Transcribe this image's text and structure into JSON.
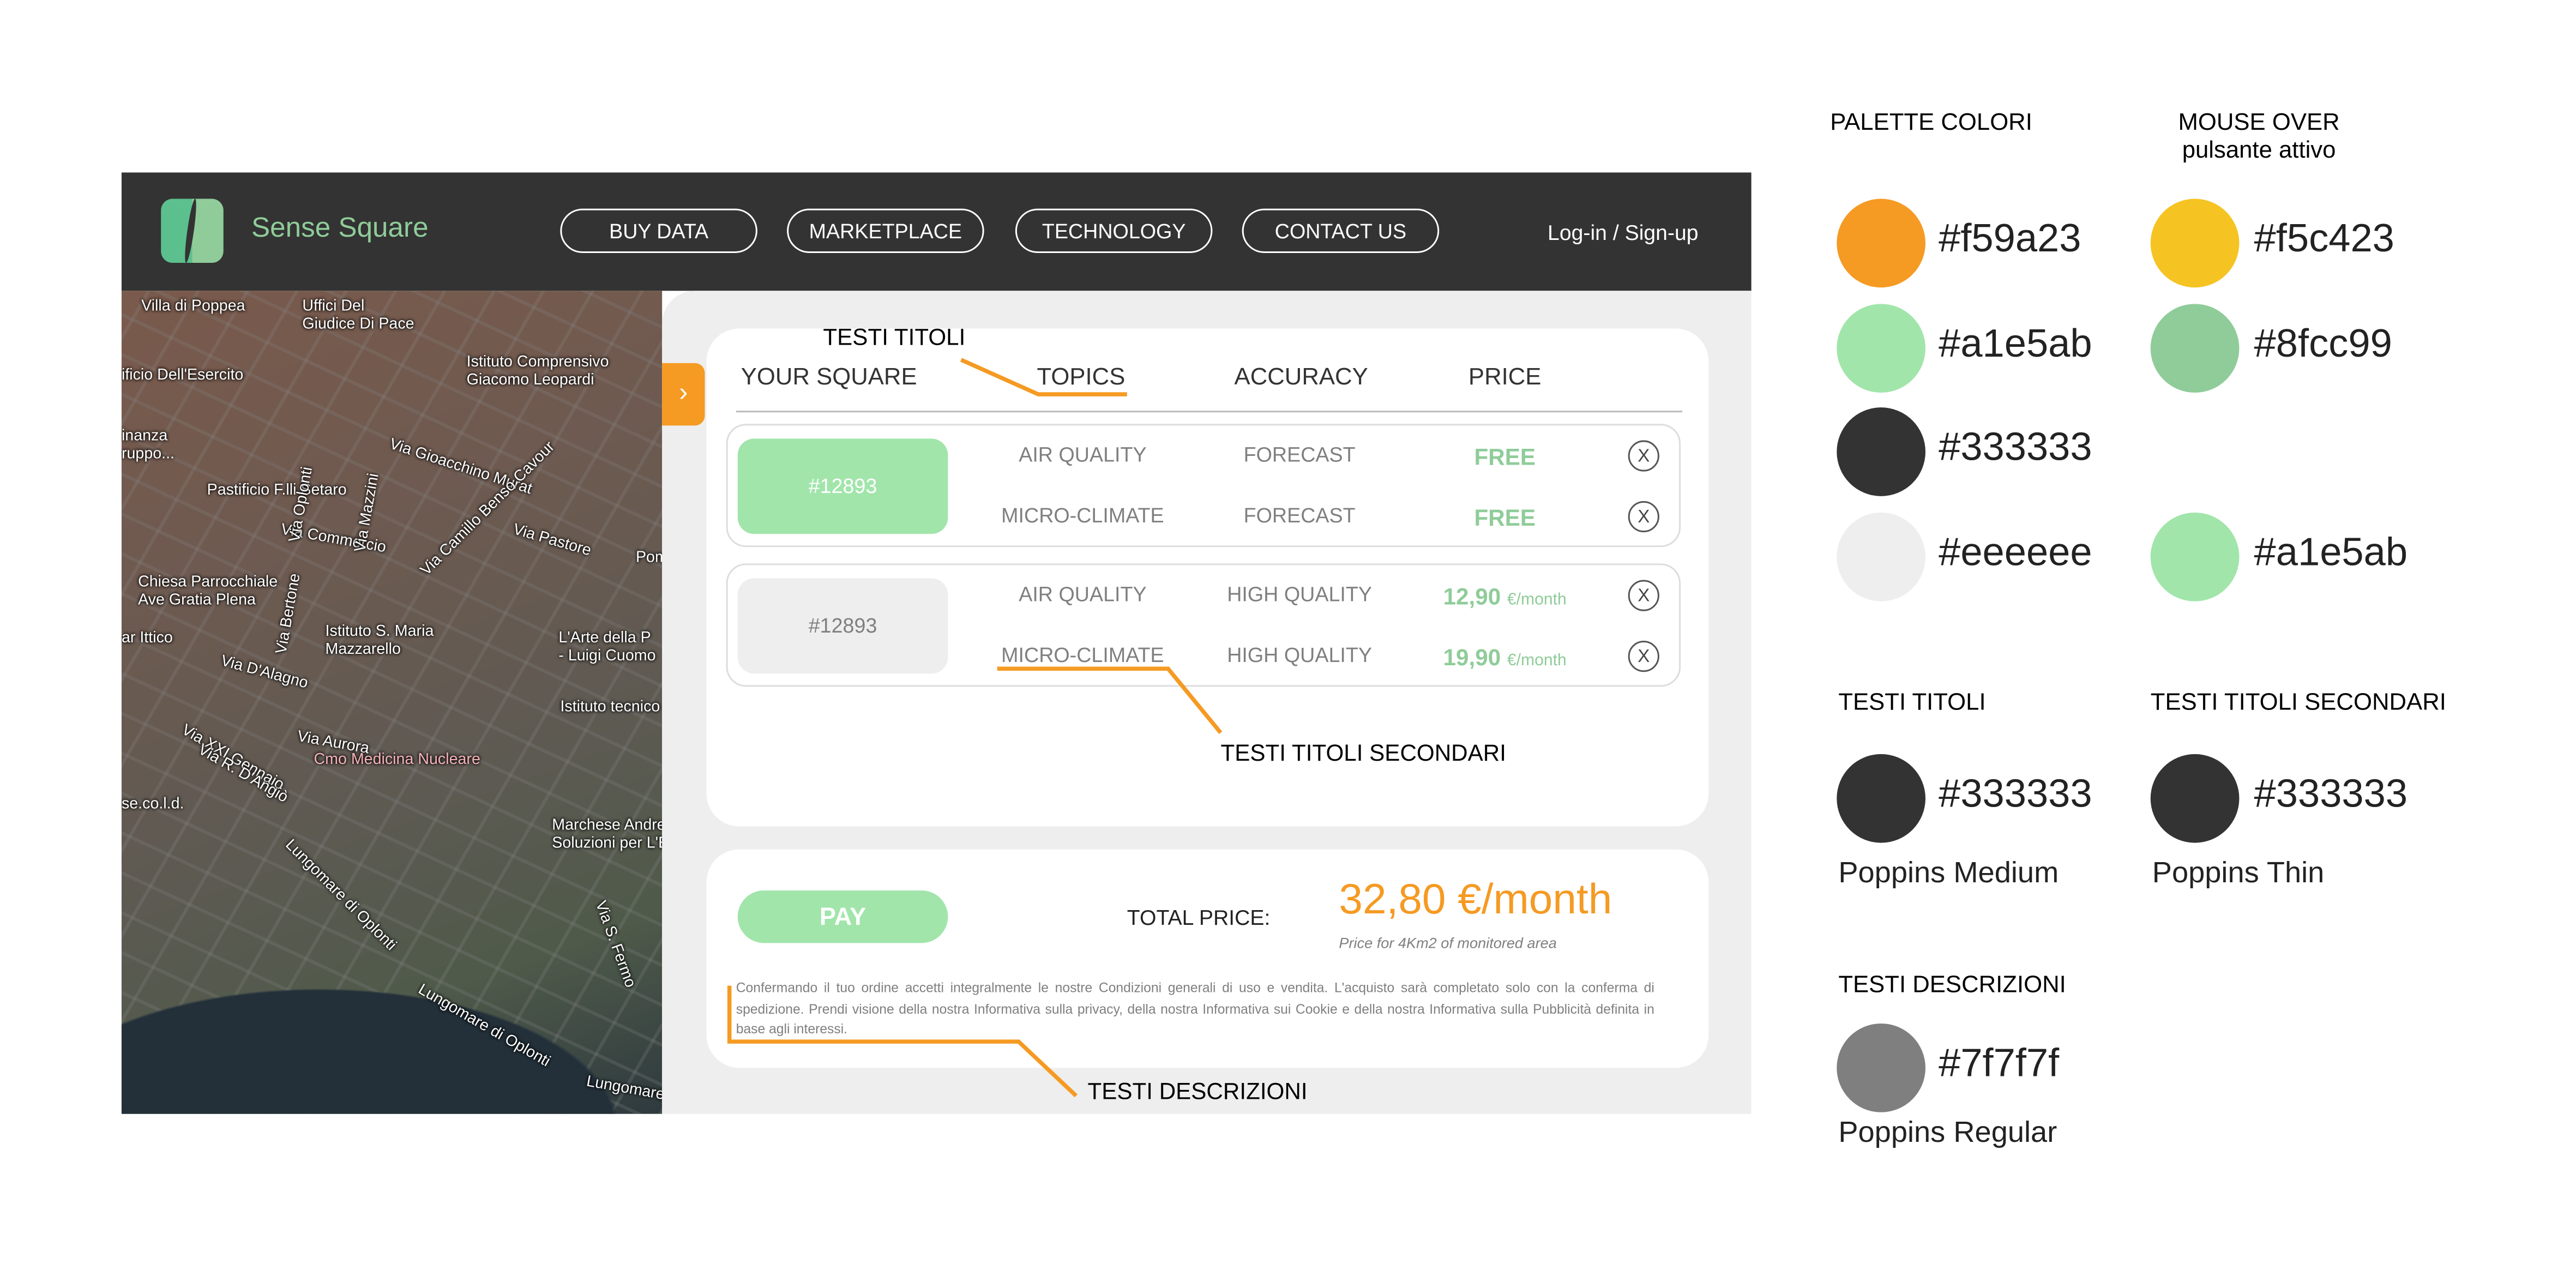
{
  "navbar": {
    "brand": "Sense Square",
    "buttons": [
      "BUY DATA",
      "MARKETPLACE",
      "TECHNOLOGY",
      "CONTACT US"
    ],
    "login": "Log-in / Sign-up"
  },
  "map": {
    "labels": [
      "Villa di Poppea",
      "Uffici Del\nGiudice Di Pace",
      "Istituto Comprensivo\nGiacomo Leopardi",
      "ificio Dell'Esercito",
      "inanza\nruppo...",
      "Via Gioacchino Murat",
      "Pastificio F.lli Setaro",
      "Via Commercio",
      "Via Pastore",
      "Via Oplonti",
      "Via Mazzini",
      "Via Camillo Benso Cavour",
      "Pom",
      "Chiesa Parrocchiale\nAve Gratia Plena",
      "ar Ittico",
      "Via D'Alagno",
      "Via Bertone",
      "Istituto S. Maria\nMazzarello",
      "L'Arte della P\n- Luigi Cuomo",
      "Istituto tecnico Marconi",
      "Via XXI Gennaio",
      "Via R. D'Angiò",
      "Via Aurora",
      "Cmo Medicina Nucleare",
      "se.co.l.d.",
      "Marchese Andrea\nSoluzioni per L'Edilizia",
      "Lungomare di Oplonti",
      "Via S. Fermo",
      "Lungomare di Oplonti",
      "Lungomare di Oplo"
    ]
  },
  "order": {
    "headers": [
      "YOUR SQUARE",
      "TOPICS",
      "ACCURACY",
      "PRICE"
    ],
    "groups": [
      {
        "square": "#12893",
        "selected": true,
        "rows": [
          {
            "topic": "AIR QUALITY",
            "accuracy": "FORECAST",
            "price": "FREE",
            "unit": ""
          },
          {
            "topic": "MICRO-CLIMATE",
            "accuracy": "FORECAST",
            "price": "FREE",
            "unit": ""
          }
        ]
      },
      {
        "square": "#12893",
        "selected": false,
        "rows": [
          {
            "topic": "AIR QUALITY",
            "accuracy": "HIGH QUALITY",
            "price": "12,90",
            "unit": "€/month"
          },
          {
            "topic": "MICRO-CLIMATE",
            "accuracy": "HIGH QUALITY",
            "price": "19,90",
            "unit": "€/month"
          }
        ]
      }
    ],
    "remove_icon": "X"
  },
  "checkout": {
    "pay": "PAY",
    "total_label": "TOTAL PRICE:",
    "total": "32,80 €/month",
    "note": "Price for 4Km2 of monitored area",
    "description": "Confermando il tuo ordine accetti integralmente le nostre Condizioni generali di uso e vendita. L'acquisto sarà completato solo con la conferma di spedizione. Prendi visione della nostra Informativa sulla privacy, della nostra Informativa sui Cookie e della nostra Informativa sulla Pubblicità definita in base agli interessi."
  },
  "annotations": {
    "titles": "TESTI TITOLI",
    "secondary": "TESTI TITOLI SECONDARI",
    "descriptions": "TESTI DESCRIZIONI"
  },
  "palette": {
    "title": "PALETTE COLORI",
    "hover_title": "MOUSE OVER",
    "hover_subtitle": "pulsante attivo",
    "colors": [
      "#f59a23",
      "#a1e5ab",
      "#333333",
      "#eeeeee"
    ],
    "hover_colors": [
      "#f5c423",
      "#8fcc99",
      "#a1e5ab"
    ],
    "text_styles": [
      {
        "label": "TESTI TITOLI",
        "color": "#333333",
        "font": "Poppins Medium"
      },
      {
        "label": "TESTI TITOLI SECONDARI",
        "color": "#333333",
        "font": "Poppins Thin"
      },
      {
        "label": "TESTI DESCRIZIONI",
        "color": "#7f7f7f",
        "font": "Poppins Regular"
      }
    ]
  }
}
